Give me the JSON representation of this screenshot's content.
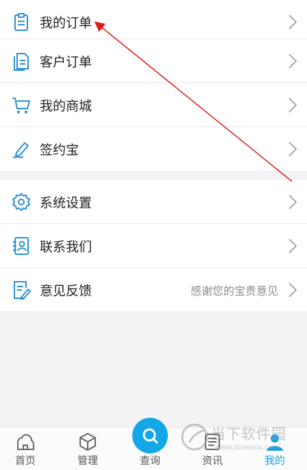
{
  "menu_group1": [
    {
      "label": "我的订单",
      "icon": "clipboard-list-icon"
    },
    {
      "label": "客户订单",
      "icon": "document-icon"
    },
    {
      "label": "我的商城",
      "icon": "shopping-cart-icon"
    },
    {
      "label": "签约宝",
      "icon": "pen-sign-icon"
    }
  ],
  "menu_group2": [
    {
      "label": "系统设置",
      "icon": "gear-icon"
    },
    {
      "label": "联系我们",
      "icon": "contact-book-icon"
    },
    {
      "label": "意见反馈",
      "icon": "feedback-edit-icon",
      "hint": "感谢您的宝贵意见"
    }
  ],
  "tabbar": [
    {
      "label": "首页",
      "icon": "home-icon"
    },
    {
      "label": "管理",
      "icon": "cube-icon"
    },
    {
      "label": "查询",
      "icon": "search-icon"
    },
    {
      "label": "资讯",
      "icon": "news-icon"
    },
    {
      "label": "我的",
      "icon": "user-icon",
      "active": true
    }
  ],
  "watermark": {
    "name": "当下软件园",
    "url": "www.downxia.com"
  },
  "colors": {
    "accent": "#1a9fe0",
    "annotation_arrow": "#e01919",
    "icon_blue": "#2a8fd6"
  }
}
